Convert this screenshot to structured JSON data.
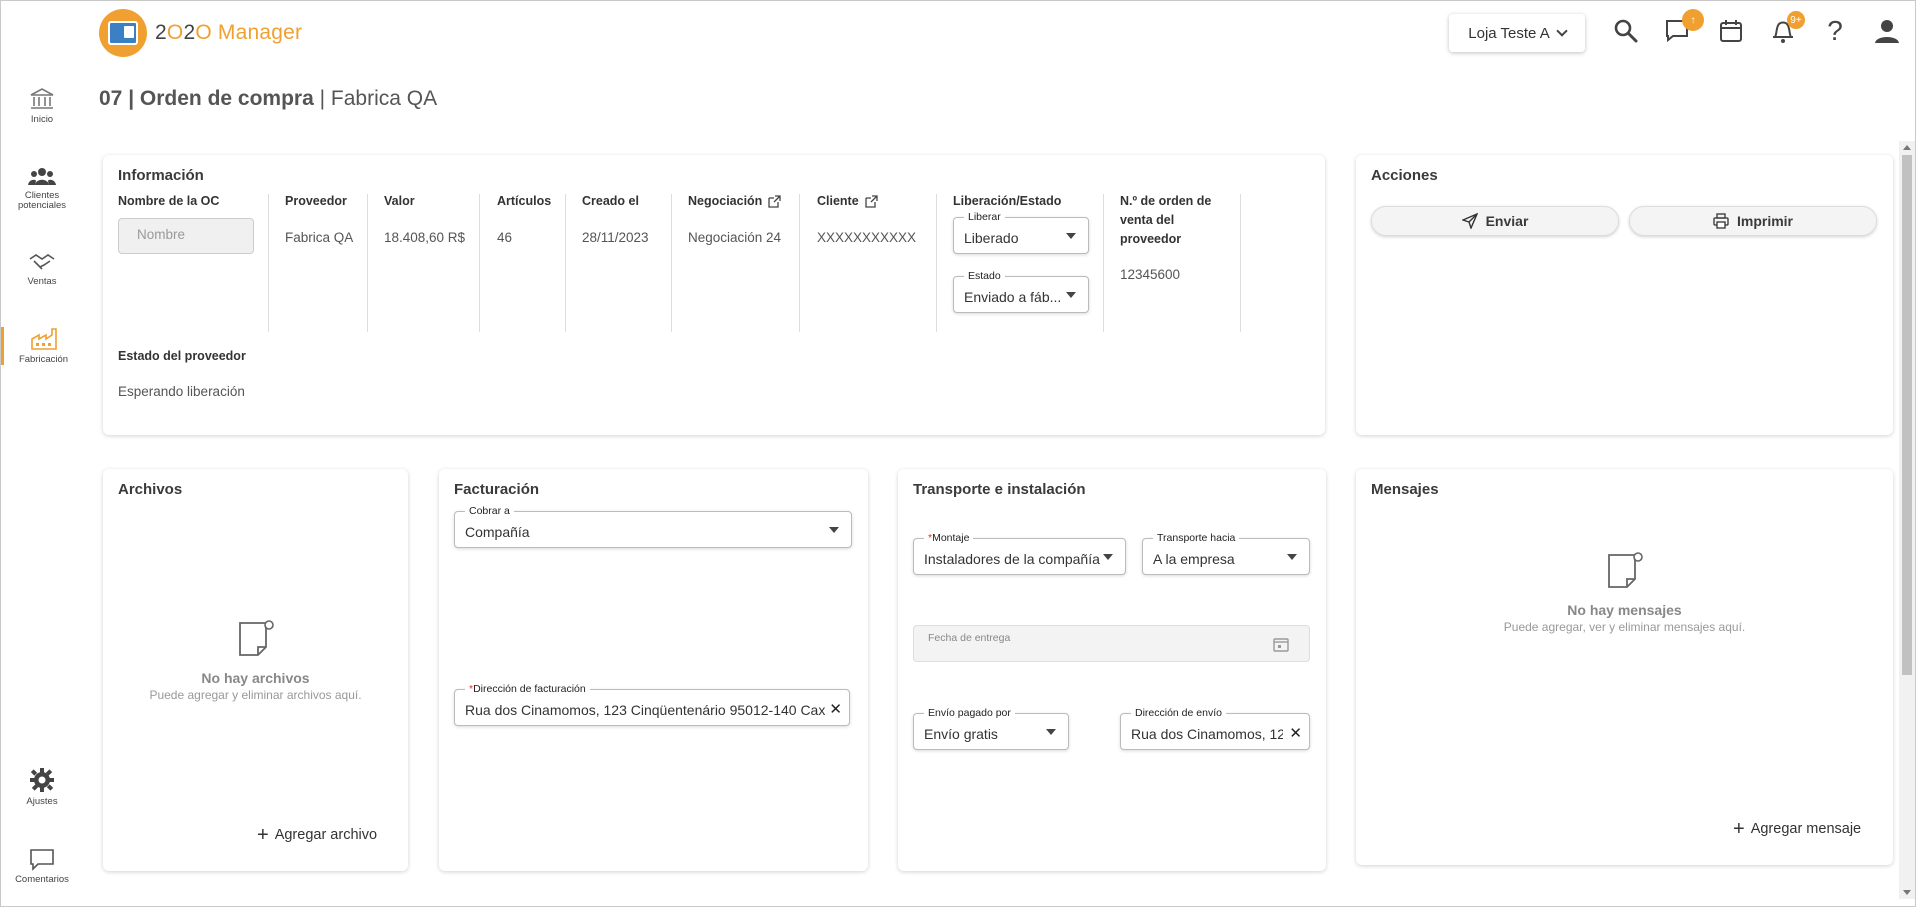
{
  "app": {
    "logo_text_prefix": "2",
    "logo_text_mid": "O",
    "logo_text_rest": "2O Manager",
    "brand_color": "#f0a030"
  },
  "header": {
    "store_label": "Loja Teste A",
    "messages_badge": "↑",
    "notifications_badge": "9+",
    "icons": [
      "search-icon",
      "chat-icon",
      "calendar-icon",
      "bell-icon",
      "help-icon",
      "user-icon"
    ]
  },
  "sidebar": {
    "items": [
      {
        "label": "Inicio",
        "icon": "bank-icon"
      },
      {
        "label": "Clientes potenciales",
        "icon": "people-icon"
      },
      {
        "label": "Ventas",
        "icon": "handshake-icon"
      },
      {
        "label": "Fabricación",
        "icon": "factory-icon",
        "active": true
      },
      {
        "label": "Ajustes",
        "icon": "gear-icon"
      },
      {
        "label": "Comentarios",
        "icon": "comment-icon"
      }
    ]
  },
  "page": {
    "title_bold": "07 | Orden de compra",
    "title_rest": " | Fabrica QA"
  },
  "informacion": {
    "title": "Información",
    "oc_name_label": "Nombre de la OC",
    "oc_name_placeholder": "Nombre",
    "proveedor_label": "Proveedor",
    "proveedor_value": "Fabrica QA",
    "valor_label": "Valor",
    "valor_value": "18.408,60 R$",
    "articulos_label": "Artículos",
    "articulos_value": "46",
    "creado_label": "Creado el",
    "creado_value": "28/11/2023",
    "negociacion_label": "Negociación",
    "negociacion_value": "Negociación 24",
    "cliente_label": "Cliente",
    "cliente_value": "XXXXXXXXXXX",
    "liberacion_label": "Liberación/Estado",
    "liberar_label": "Liberar",
    "liberar_value": "Liberado",
    "estado_label": "Estado",
    "estado_value": "Enviado a fáb...",
    "orden_label": "N.º de orden de venta del proveedor",
    "orden_value": "12345600",
    "estado_proveedor_label": "Estado del proveedor",
    "estado_proveedor_value": "Esperando liberación"
  },
  "acciones": {
    "title": "Acciones",
    "enviar": "Enviar",
    "imprimir": "Imprimir"
  },
  "archivos": {
    "title": "Archivos",
    "empty_title": "No hay archivos",
    "empty_sub": "Puede agregar y eliminar archivos aquí.",
    "add_label": "Agregar archivo"
  },
  "facturacion": {
    "title": "Facturación",
    "cobrar_label": "Cobrar a",
    "cobrar_value": "Compañía",
    "direccion_label": "Dirección de facturación",
    "direccion_value": "Rua dos Cinamomos, 123 Cinqüentenário 95012-140 Caxi"
  },
  "transporte": {
    "title": "Transporte e instalación",
    "montaje_label": "Montaje",
    "montaje_value": "Instaladores de la compañía",
    "transporte_label": "Transporte hacia",
    "transporte_value": "A la empresa",
    "fecha_label": "Fecha de entrega",
    "envio_label": "Envío pagado por",
    "envio_value": "Envío gratis",
    "direccion_envio_label": "Dirección de envío",
    "direccion_envio_value": "Rua dos Cinamomos, 12"
  },
  "mensajes": {
    "title": "Mensajes",
    "empty_title": "No hay mensajes",
    "empty_sub": "Puede agregar, ver y eliminar mensajes aquí.",
    "add_label": "Agregar mensaje"
  }
}
